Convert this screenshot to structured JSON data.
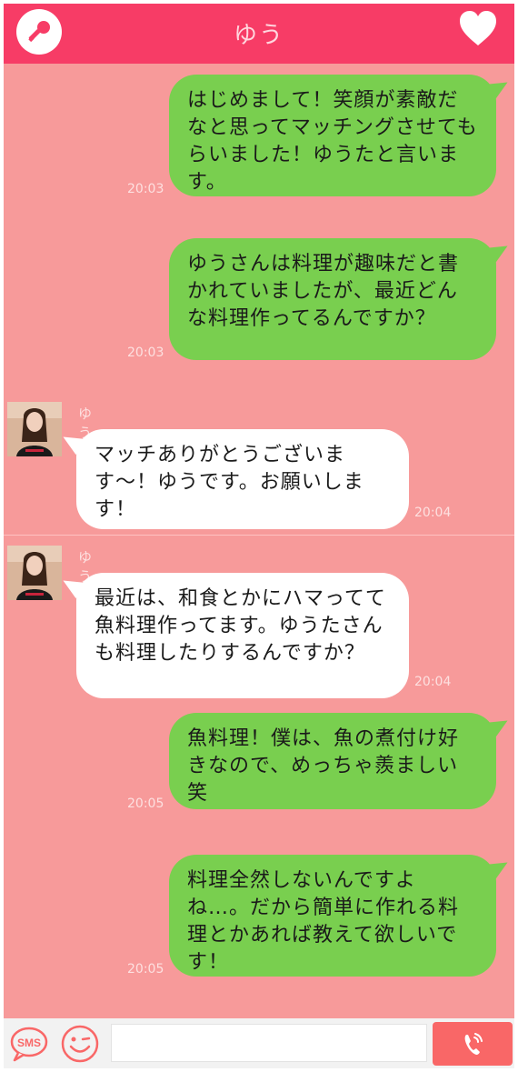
{
  "header": {
    "title": "ゆう",
    "key_icon": "key-icon",
    "heart_icon": "heart-icon"
  },
  "messages": [
    {
      "from": "me",
      "text": "はじめまして！笑顔が素敵だなと思ってマッチングさせてもらいました！ゆうたと言います。",
      "time": "20:03"
    },
    {
      "from": "me",
      "text": "ゆうさんは料理が趣味だと書かれていましたが、最近どんな料理作ってるんですか？",
      "time": "20:03"
    },
    {
      "from": "them",
      "sender": "ゆう",
      "text": "マッチありがとうございます〜！ゆうです。お願いします！",
      "time": "20:04"
    },
    {
      "from": "them",
      "sender": "ゆう",
      "text": "最近は、和食とかにハマってて魚料理作ってます。ゆうたさんも料理したりするんですか？",
      "time": "20:04"
    },
    {
      "from": "me",
      "text": "魚料理！僕は、魚の煮付け好きなので、めっちゃ羨ましい笑",
      "time": "20:05"
    },
    {
      "from": "me",
      "text": "料理全然しないんですよね…。だから簡単に作れる料理とかあれば教えて欲しいです！",
      "time": "20:05"
    }
  ],
  "footer": {
    "sms_label": "SMS",
    "input_value": "",
    "call_icon": "phone-icon",
    "smile_icon": "smiley-icon"
  },
  "colors": {
    "header": "#f73c66",
    "background": "#f79a9a",
    "my_bubble": "#79cf4f",
    "their_bubble": "#ffffff",
    "send_button": "#f96767"
  }
}
